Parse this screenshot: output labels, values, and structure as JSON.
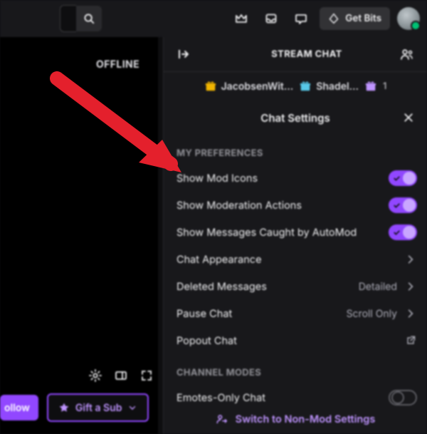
{
  "topbar": {
    "getbits_label": "Get Bits"
  },
  "video": {
    "offline_label": "OFFLINE",
    "follow_label": "ollow",
    "gift_label": "Gift a Sub"
  },
  "chat": {
    "header_title": "STREAM CHAT",
    "gifters": [
      {
        "name": "JacobsenWit…",
        "icon": "gold"
      },
      {
        "name": "Shadel…",
        "icon": "blue"
      },
      {
        "name": "1",
        "icon": "purple",
        "is_count": true
      }
    ]
  },
  "settings": {
    "title": "Chat Settings",
    "sections": [
      {
        "label": "MY PREFERENCES",
        "rows": [
          {
            "label": "Show Mod Icons",
            "type": "toggle",
            "on": true
          },
          {
            "label": "Show Moderation Actions",
            "type": "toggle",
            "on": true
          },
          {
            "label": "Show Messages Caught by AutoMod",
            "type": "toggle",
            "on": true
          },
          {
            "label": "Chat Appearance",
            "type": "nav"
          },
          {
            "label": "Deleted Messages",
            "type": "nav",
            "value": "Detailed"
          },
          {
            "label": "Pause Chat",
            "type": "nav",
            "value": "Scroll Only"
          },
          {
            "label": "Popout Chat",
            "type": "popout"
          }
        ]
      },
      {
        "label": "CHANNEL MODES",
        "rows": [
          {
            "label": "Emotes-Only Chat",
            "type": "toggle",
            "on": false
          }
        ]
      }
    ],
    "switch_label": "Switch to Non-Mod Settings"
  }
}
